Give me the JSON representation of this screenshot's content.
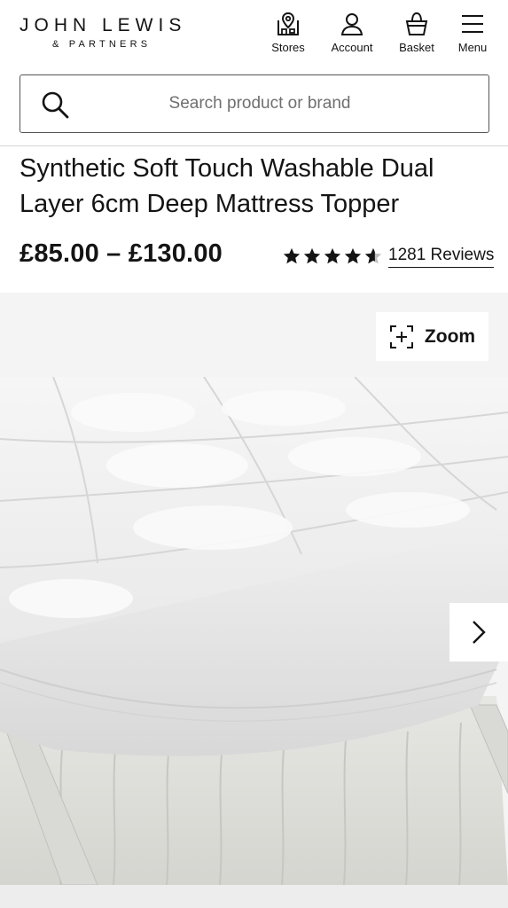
{
  "header": {
    "logo_main": "JOHN LEWIS",
    "logo_sub": "& PARTNERS",
    "nav": {
      "stores": {
        "label": "Stores",
        "icon": "store-pin-icon"
      },
      "account": {
        "label": "Account",
        "icon": "user-icon"
      },
      "basket": {
        "label": "Basket",
        "icon": "basket-icon"
      },
      "menu": {
        "label": "Menu",
        "icon": "hamburger-icon"
      }
    }
  },
  "search": {
    "placeholder": "Search product or brand",
    "icon": "search-icon"
  },
  "product": {
    "title": "Synthetic Soft Touch Washable Dual Layer 6cm Deep Mattress Topper",
    "price": "£85.00 – £130.00",
    "rating": {
      "value": 4.5,
      "max": 5,
      "reviews_label": "1281 Reviews"
    }
  },
  "gallery": {
    "zoom_label": "Zoom",
    "zoom_icon": "zoom-expand-icon",
    "next_icon": "chevron-right-icon"
  },
  "colors": {
    "text": "#141414",
    "gallery_bg": "#f4f4f4",
    "border": "#555555"
  }
}
